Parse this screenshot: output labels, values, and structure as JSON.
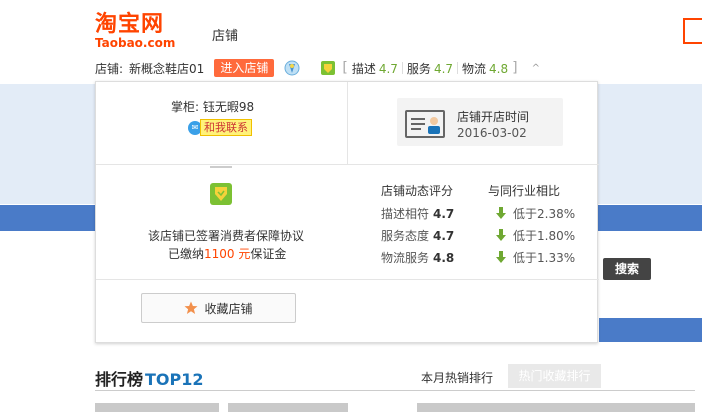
{
  "header": {
    "logo_cn": "淘宝网",
    "logo_en": "Taobao.com",
    "channel": "店铺"
  },
  "shopbar": {
    "shop_label": "店铺:",
    "shop_name": "新概念鞋店01",
    "enter_label": "进入店铺",
    "ratings": [
      {
        "label": "描述",
        "value": "4.7"
      },
      {
        "label": "服务",
        "value": "4.7"
      },
      {
        "label": "物流",
        "value": "4.8"
      }
    ],
    "bracket_open": "[",
    "bracket_close": "]",
    "caret": "^"
  },
  "popup": {
    "owner": "掌柜: 钰无暇98",
    "contact_label": "和我联系",
    "open_title": "店铺开店时间",
    "open_date": "2016-03-02",
    "agreement_line1": "该店铺已签署消费者保障协议",
    "agreement_pre": "已缴纳",
    "deposit": "1100",
    "deposit_unit": "元",
    "agreement_post": "保证金",
    "score_header": "店铺动态评分",
    "compare_header": "与同行业相比",
    "scores": [
      {
        "label": "描述相符",
        "value": "4.7",
        "compare": "低于2.38%"
      },
      {
        "label": "服务态度",
        "value": "4.7",
        "compare": "低于1.80%"
      },
      {
        "label": "物流服务",
        "value": "4.8",
        "compare": "低于1.33%"
      }
    ],
    "favorite_label": "收藏店铺"
  },
  "background": {
    "search_label": "搜索",
    "rank_title": "排行榜",
    "rank_top": "TOP12",
    "rank_tab_sales": "本月热销排行",
    "rank_tab_fav": "热门收藏排行"
  },
  "colors": {
    "brand": "#ff4400",
    "rating_green": "#6fa832",
    "accent_blue": "#4a7bc8"
  }
}
